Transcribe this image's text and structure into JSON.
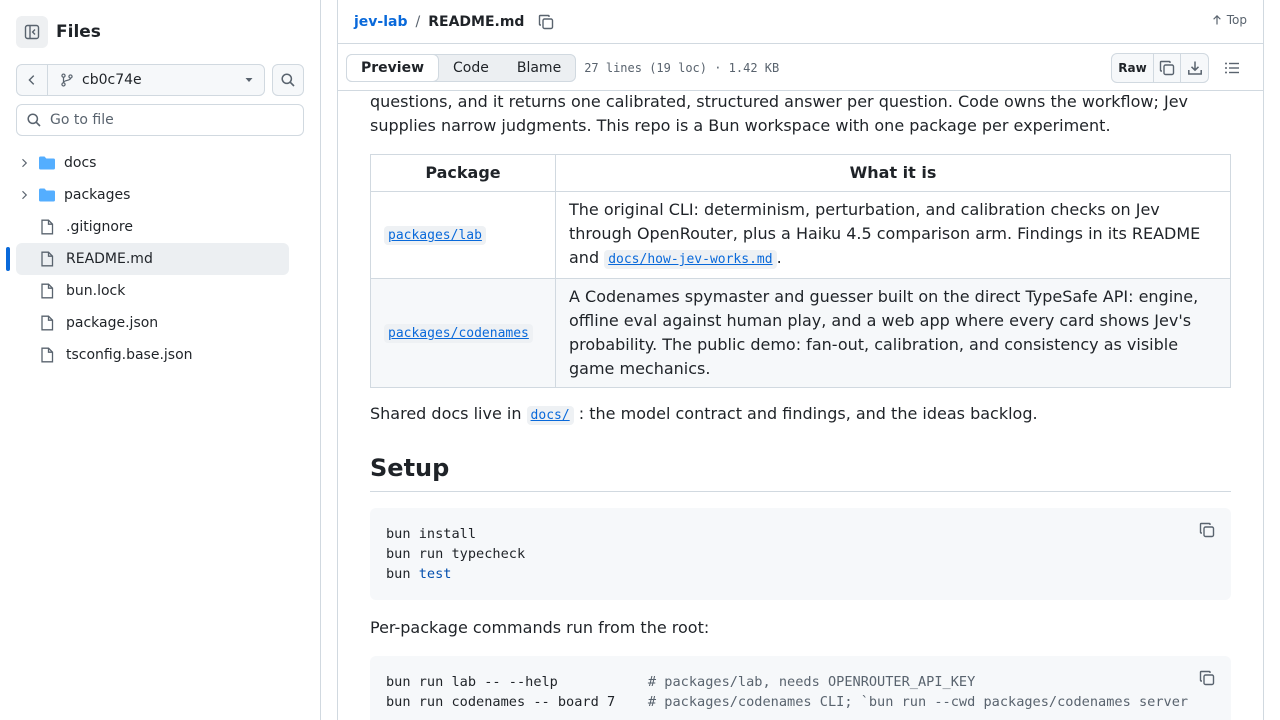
{
  "sidebar": {
    "title": "Files",
    "branch": "cb0c74e",
    "goto_placeholder": "Go to file",
    "items": [
      {
        "label": "docs",
        "type": "folder"
      },
      {
        "label": "packages",
        "type": "folder"
      },
      {
        "label": ".gitignore",
        "type": "file"
      },
      {
        "label": "README.md",
        "type": "file",
        "selected": true
      },
      {
        "label": "bun.lock",
        "type": "file"
      },
      {
        "label": "package.json",
        "type": "file"
      },
      {
        "label": "tsconfig.base.json",
        "type": "file"
      }
    ]
  },
  "header": {
    "repo": "jev-lab",
    "separator": "/",
    "file": "README.md",
    "top_label": "Top"
  },
  "toolbar": {
    "tabs": [
      "Preview",
      "Code",
      "Blame"
    ],
    "active_tab": "Preview",
    "meta": "27 lines (19 loc) · 1.42 KB",
    "raw_label": "Raw"
  },
  "readme": {
    "intro_line1": "questions, and it returns one calibrated, structured answer per question. Code owns the workflow; Jev",
    "intro_line2": "supplies narrow judgments. This repo is a Bun workspace with one package per experiment.",
    "table": {
      "headers": [
        "Package",
        "What it is"
      ],
      "rows": [
        {
          "package": "packages/lab",
          "desc_before": "The original CLI: determinism, perturbation, and calibration checks on Jev through OpenRouter, plus a Haiku 4.5 comparison arm. Findings in its README and",
          "desc_link": "docs/how-jev-works.md",
          "desc_after": "."
        },
        {
          "package": "packages/codenames",
          "desc_before": "A Codenames spymaster and guesser built on the direct TypeSafe API: engine, offline eval against human play, and a web app where every card shows Jev's probability. The public demo: fan-out, calibration, and consistency as visible game mechanics.",
          "desc_link": "",
          "desc_after": ""
        }
      ]
    },
    "shared_before": "Shared docs live in",
    "shared_link": "docs/",
    "shared_after": ": the model contract and findings, and the ideas backlog.",
    "setup_heading": "Setup",
    "setup_code": {
      "line1": "bun install",
      "line2": "bun run typecheck",
      "line3_cmd": "bun ",
      "line3_kw": "test"
    },
    "percmd_text": "Per-package commands run from the root:",
    "percmd_code": {
      "line1_cmd": "bun run lab -- --help           ",
      "line1_cm": "# packages/lab, needs OPENROUTER_API_KEY",
      "line2_cmd": "bun run codenames -- board 7    ",
      "line2_cm": "# packages/codenames CLI; `bun run --cwd packages/codenames server"
    }
  },
  "colors": {
    "accent": "#0969da",
    "folder": "#54aeff",
    "border": "#d1d9e0",
    "muted": "#59636e"
  }
}
